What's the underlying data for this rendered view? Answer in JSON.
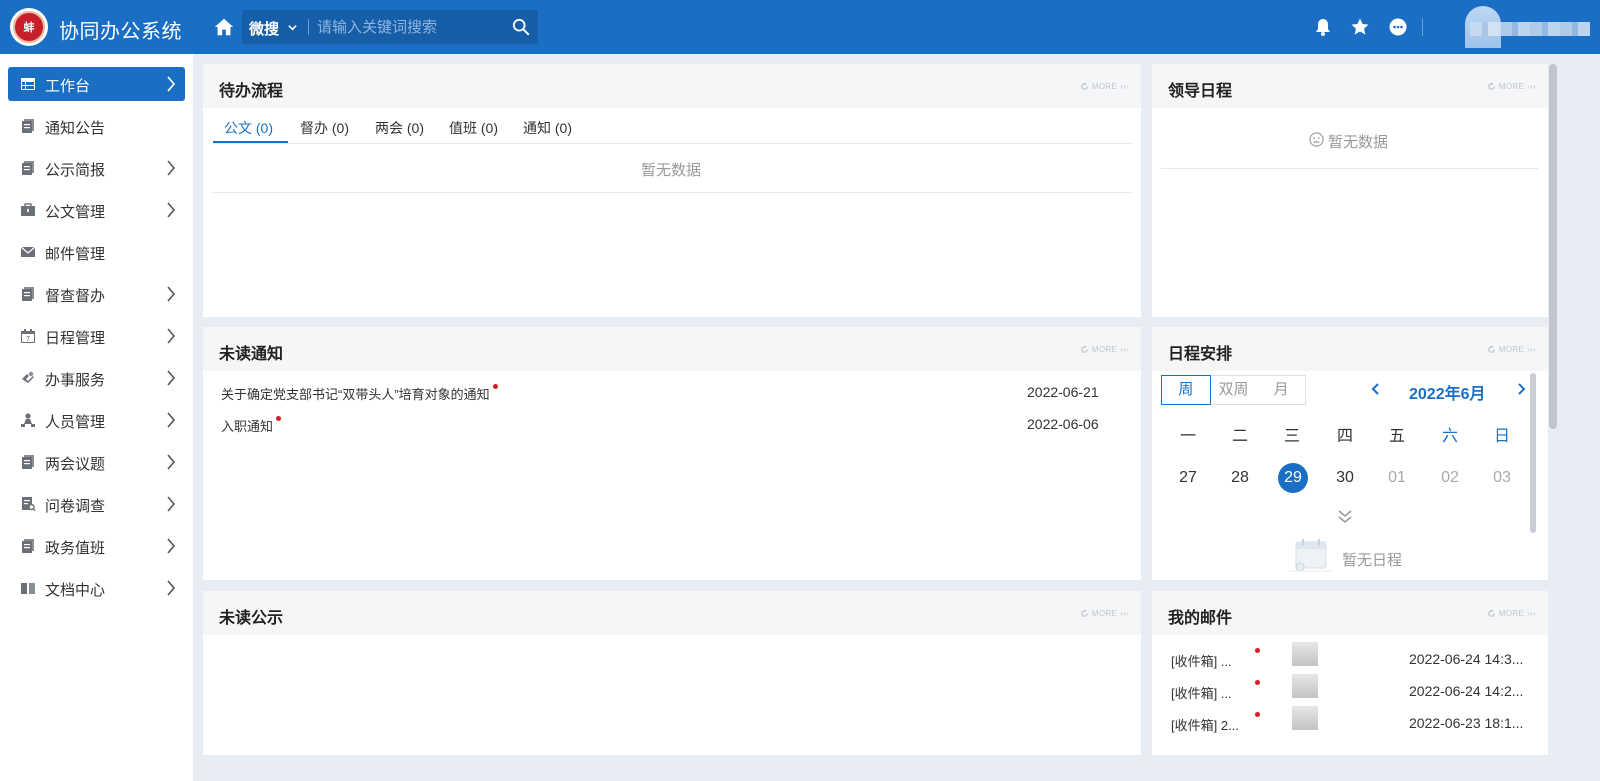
{
  "header": {
    "app_title": "协同办公系统",
    "logo_text": "蚌",
    "search_scope": "微搜",
    "search_placeholder": "请输入关键词搜索",
    "icons": [
      "home-icon",
      "search-icon",
      "bell-icon",
      "star-icon",
      "chat-icon"
    ]
  },
  "sidebar": {
    "items": [
      {
        "label": "工作台",
        "icon": "dashboard-icon",
        "has_children": true,
        "active": true
      },
      {
        "label": "通知公告",
        "icon": "document-icon",
        "has_children": false
      },
      {
        "label": "公示简报",
        "icon": "document-icon",
        "has_children": true
      },
      {
        "label": "公文管理",
        "icon": "briefcase-icon",
        "has_children": true
      },
      {
        "label": "邮件管理",
        "icon": "mail-icon",
        "has_children": false
      },
      {
        "label": "督查督办",
        "icon": "document-icon",
        "has_children": true
      },
      {
        "label": "日程管理",
        "icon": "calendar-icon",
        "has_children": true
      },
      {
        "label": "办事服务",
        "icon": "service-icon",
        "has_children": true
      },
      {
        "label": "人员管理",
        "icon": "org-icon",
        "has_children": true
      },
      {
        "label": "两会议题",
        "icon": "document-icon",
        "has_children": true
      },
      {
        "label": "问卷调查",
        "icon": "survey-icon",
        "has_children": true
      },
      {
        "label": "政务值班",
        "icon": "document-icon",
        "has_children": true
      },
      {
        "label": "文档中心",
        "icon": "book-icon",
        "has_children": true
      }
    ]
  },
  "more_label": "MORE",
  "pending": {
    "title": "待办流程",
    "tabs": [
      {
        "label": "公文 (0)",
        "active": true
      },
      {
        "label": "督办 (0)"
      },
      {
        "label": "两会 (0)"
      },
      {
        "label": "值班 (0)"
      },
      {
        "label": "通知 (0)"
      }
    ],
    "empty": "暂无数据"
  },
  "leader_schedule": {
    "title": "领导日程",
    "empty": "暂无数据"
  },
  "unread_notices": {
    "title": "未读通知",
    "items": [
      {
        "title": "关于确定党支部书记“双带头人”培育对象的通知",
        "date": "2022-06-21",
        "unread": true
      },
      {
        "title": "入职通知",
        "date": "2022-06-06",
        "unread": true
      }
    ]
  },
  "schedule": {
    "title": "日程安排",
    "view_modes": [
      "周",
      "双周",
      "月"
    ],
    "active_view": "周",
    "month": "2022年6月",
    "weekdays": [
      "一",
      "二",
      "三",
      "四",
      "五",
      "六",
      "日"
    ],
    "days": [
      "27",
      "28",
      "29",
      "30",
      "01",
      "02",
      "03"
    ],
    "today": "29",
    "empty": "暂无日程",
    "colors": {
      "accent": "#1a6fc4"
    }
  },
  "unread_public": {
    "title": "未读公示"
  },
  "mail": {
    "title": "我的邮件",
    "items": [
      {
        "label": "[收件箱] ...",
        "time": "2022-06-24 14:3...",
        "unread": true
      },
      {
        "label": "[收件箱] ...",
        "time": "2022-06-24 14:2...",
        "unread": true
      },
      {
        "label": "[收件箱] 2...",
        "time": "2022-06-23 18:1...",
        "unread": true
      }
    ]
  },
  "theme": {
    "primary": "#1a6fc4",
    "unread_dot": "#e0191f",
    "background": "#e8edf3"
  }
}
